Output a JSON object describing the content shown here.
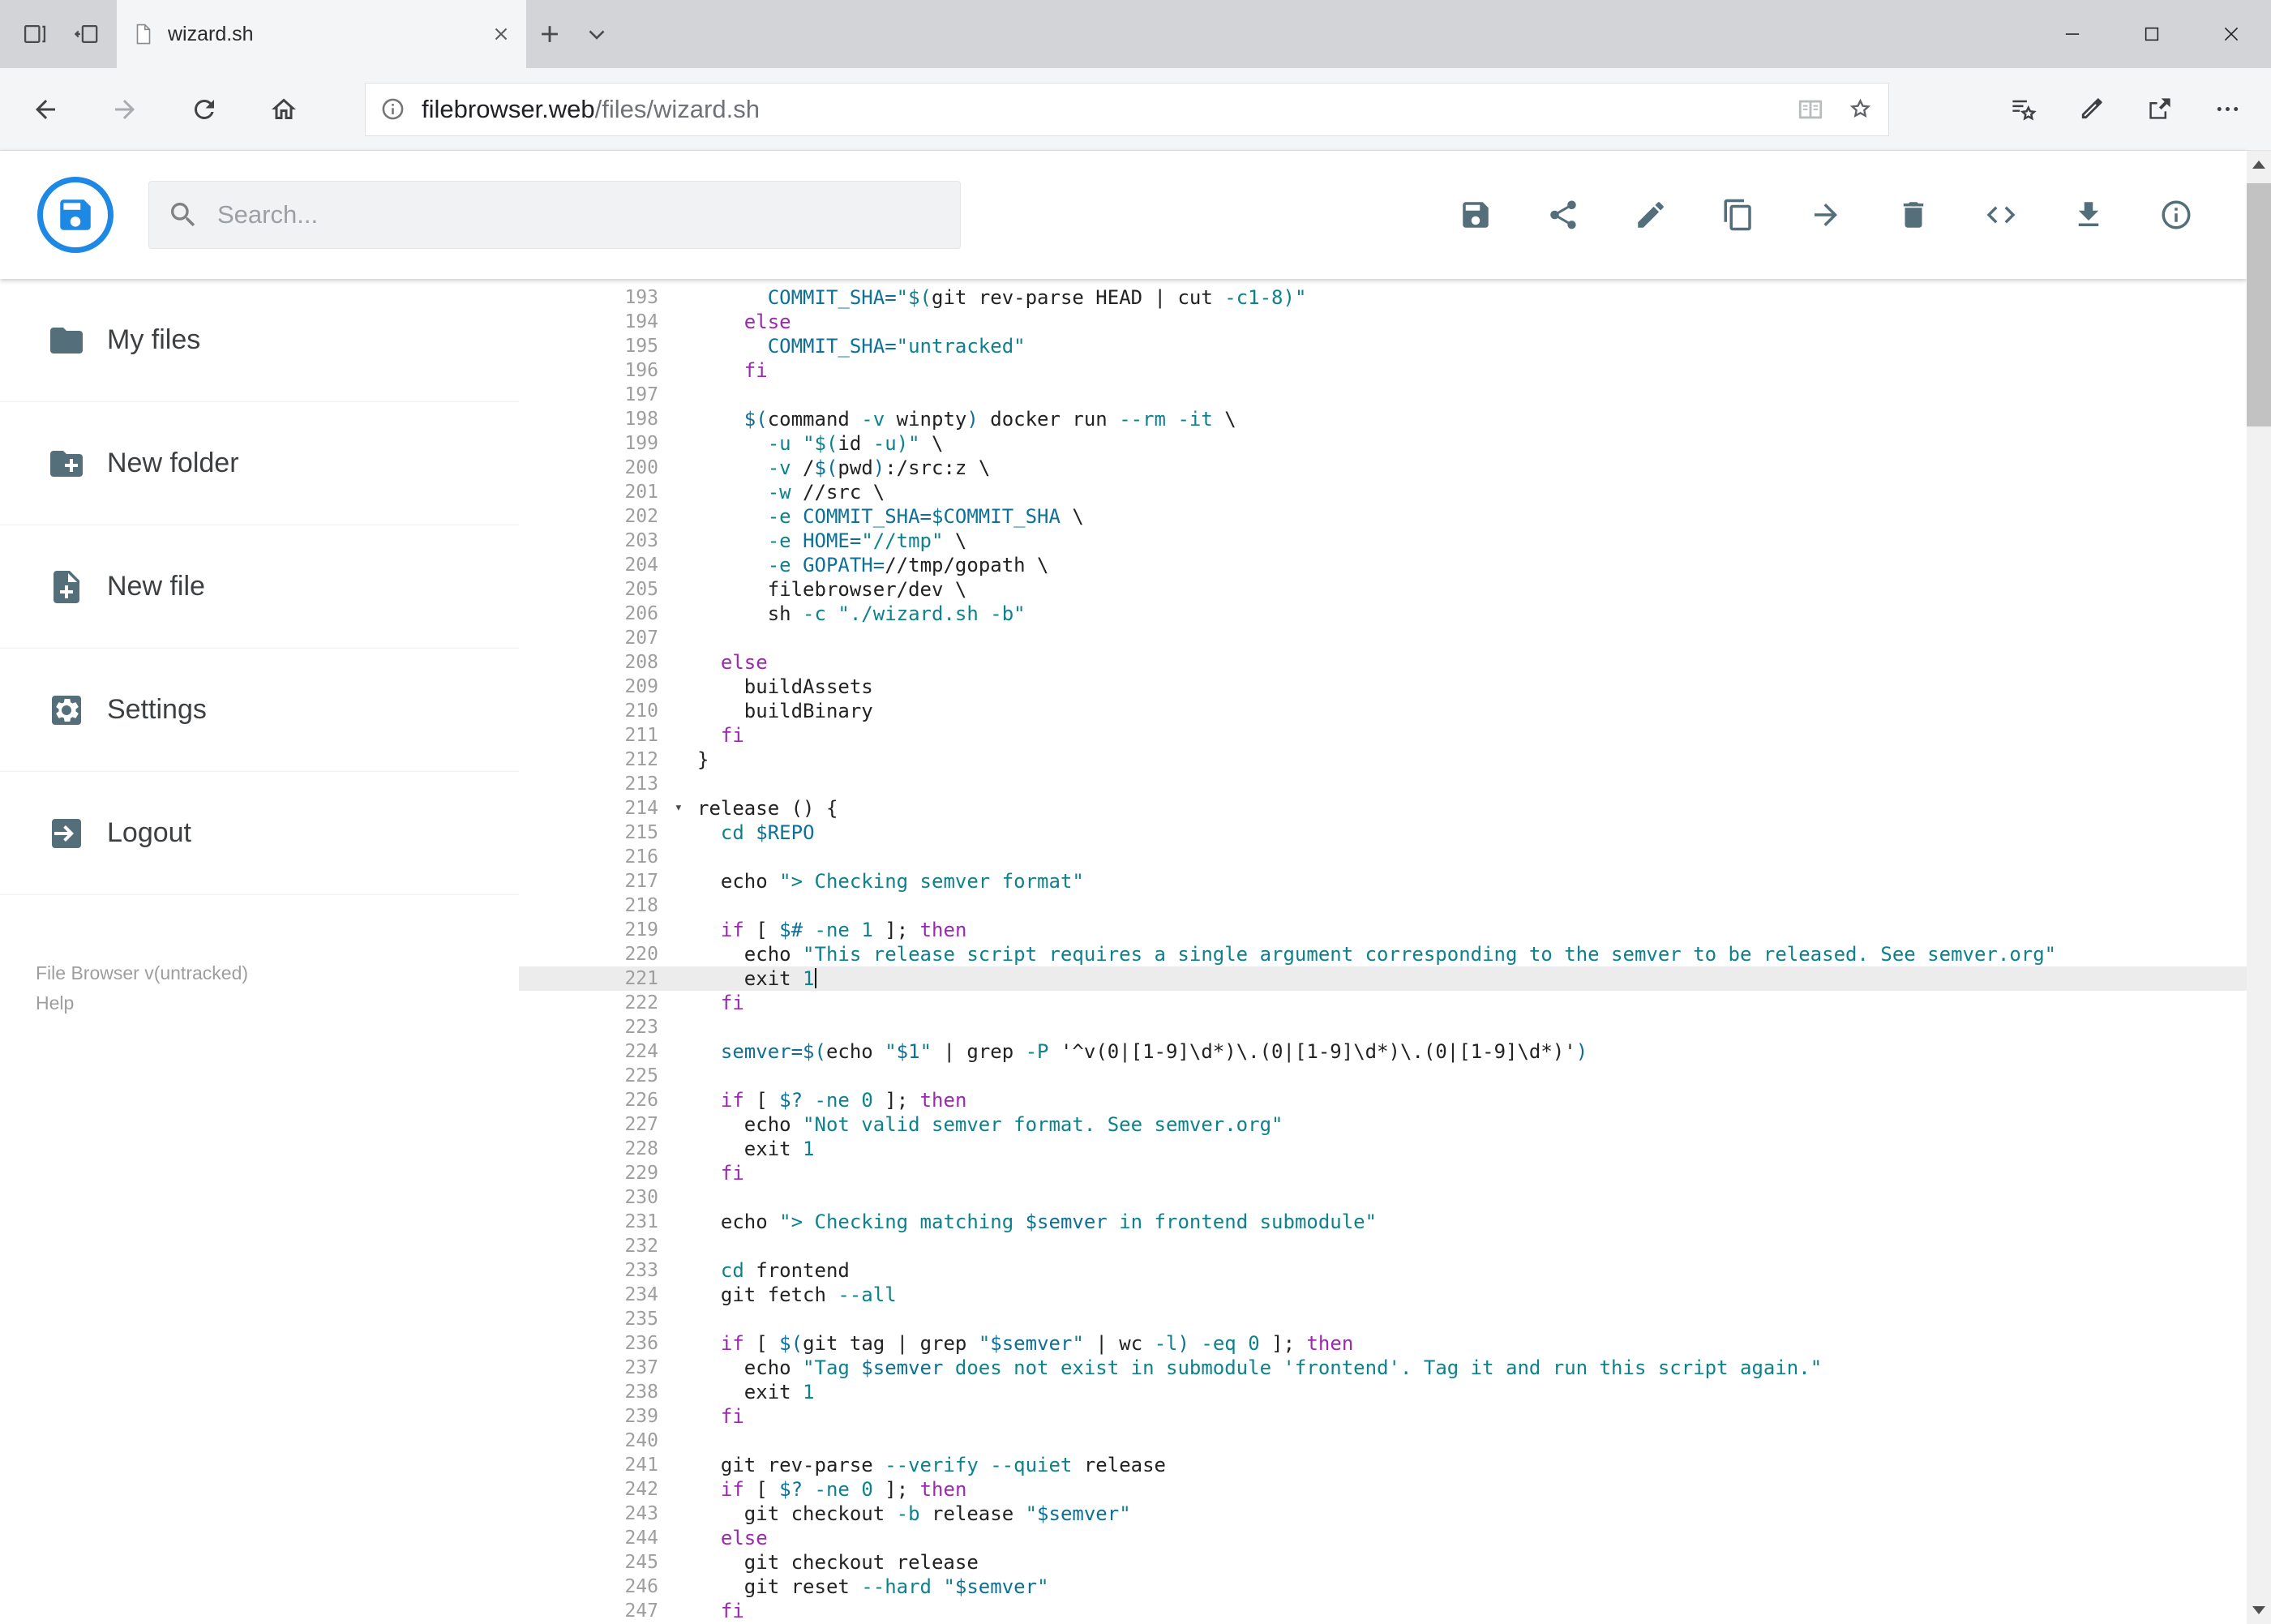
{
  "browser": {
    "tab_title": "wizard.sh",
    "url_domain": "filebrowser.web",
    "url_path": "/files/wizard.sh"
  },
  "header": {
    "search_placeholder": "Search...",
    "actions": [
      {
        "name": "save",
        "icon": "save"
      },
      {
        "name": "share",
        "icon": "share"
      },
      {
        "name": "rename",
        "icon": "pencil"
      },
      {
        "name": "copy",
        "icon": "copy"
      },
      {
        "name": "move",
        "icon": "arrow-forward"
      },
      {
        "name": "delete",
        "icon": "trash"
      },
      {
        "name": "code",
        "icon": "code"
      },
      {
        "name": "download",
        "icon": "download"
      },
      {
        "name": "info",
        "icon": "info"
      }
    ]
  },
  "sidebar": {
    "items": [
      {
        "label": "My files",
        "icon": "folder"
      },
      {
        "label": "New folder",
        "icon": "folder-plus"
      },
      {
        "label": "New file",
        "icon": "file-plus"
      },
      {
        "label": "Settings",
        "icon": "settings"
      },
      {
        "label": "Logout",
        "icon": "logout"
      }
    ],
    "footer_version": "File Browser v(untracked)",
    "footer_help": "Help"
  },
  "editor": {
    "active_line": 221,
    "fold_line": 214,
    "lines": [
      {
        "n": 193,
        "s": [
          [
            "p",
            "      "
          ],
          [
            "v",
            "COMMIT_SHA="
          ],
          [
            "s",
            "\"$("
          ],
          [
            "p",
            "git rev-parse HEAD | cut "
          ],
          [
            "s",
            "-c1-8"
          ],
          [
            "s",
            ")\""
          ]
        ]
      },
      {
        "n": 194,
        "s": [
          [
            "p",
            "    "
          ],
          [
            "k",
            "else"
          ]
        ]
      },
      {
        "n": 195,
        "s": [
          [
            "p",
            "      "
          ],
          [
            "v",
            "COMMIT_SHA="
          ],
          [
            "s",
            "\"untracked\""
          ]
        ]
      },
      {
        "n": 196,
        "s": [
          [
            "p",
            "    "
          ],
          [
            "k",
            "fi"
          ]
        ]
      },
      {
        "n": 197,
        "s": []
      },
      {
        "n": 198,
        "s": [
          [
            "p",
            "    "
          ],
          [
            "v",
            "$("
          ],
          [
            "p",
            "command "
          ],
          [
            "s",
            "-v"
          ],
          [
            "p",
            " winpty"
          ],
          [
            "v",
            ")"
          ],
          [
            "p",
            " docker run "
          ],
          [
            "s",
            "--rm"
          ],
          [
            "p",
            " "
          ],
          [
            "s",
            "-it"
          ],
          [
            "p",
            " \\"
          ]
        ]
      },
      {
        "n": 199,
        "s": [
          [
            "p",
            "      "
          ],
          [
            "s",
            "-u"
          ],
          [
            "p",
            " "
          ],
          [
            "s",
            "\"$("
          ],
          [
            "p",
            "id "
          ],
          [
            "s",
            "-u"
          ],
          [
            "s",
            ")\""
          ],
          [
            "p",
            " \\"
          ]
        ]
      },
      {
        "n": 200,
        "s": [
          [
            "p",
            "      "
          ],
          [
            "s",
            "-v"
          ],
          [
            "p",
            " /"
          ],
          [
            "v",
            "$("
          ],
          [
            "p",
            "pwd"
          ],
          [
            "v",
            ")"
          ],
          [
            "p",
            ":/src:z \\"
          ]
        ]
      },
      {
        "n": 201,
        "s": [
          [
            "p",
            "      "
          ],
          [
            "s",
            "-w"
          ],
          [
            "p",
            " //src \\"
          ]
        ]
      },
      {
        "n": 202,
        "s": [
          [
            "p",
            "      "
          ],
          [
            "s",
            "-e"
          ],
          [
            "p",
            " "
          ],
          [
            "v",
            "COMMIT_SHA=$COMMIT_SHA"
          ],
          [
            "p",
            " \\"
          ]
        ]
      },
      {
        "n": 203,
        "s": [
          [
            "p",
            "      "
          ],
          [
            "s",
            "-e"
          ],
          [
            "p",
            " "
          ],
          [
            "v",
            "HOME="
          ],
          [
            "s",
            "\"//tmp\""
          ],
          [
            "p",
            " \\"
          ]
        ]
      },
      {
        "n": 204,
        "s": [
          [
            "p",
            "      "
          ],
          [
            "s",
            "-e"
          ],
          [
            "p",
            " "
          ],
          [
            "v",
            "GOPATH="
          ],
          [
            "p",
            "//tmp/gopath \\"
          ]
        ]
      },
      {
        "n": 205,
        "s": [
          [
            "p",
            "      filebrowser/dev \\"
          ]
        ]
      },
      {
        "n": 206,
        "s": [
          [
            "p",
            "      sh "
          ],
          [
            "s",
            "-c"
          ],
          [
            "p",
            " "
          ],
          [
            "s",
            "\"./wizard.sh -b\""
          ]
        ]
      },
      {
        "n": 207,
        "s": []
      },
      {
        "n": 208,
        "s": [
          [
            "p",
            "  "
          ],
          [
            "k",
            "else"
          ]
        ]
      },
      {
        "n": 209,
        "s": [
          [
            "p",
            "    buildAssets"
          ]
        ]
      },
      {
        "n": 210,
        "s": [
          [
            "p",
            "    buildBinary"
          ]
        ]
      },
      {
        "n": 211,
        "s": [
          [
            "p",
            "  "
          ],
          [
            "k",
            "fi"
          ]
        ]
      },
      {
        "n": 212,
        "s": [
          [
            "p",
            "}"
          ]
        ]
      },
      {
        "n": 213,
        "s": []
      },
      {
        "n": 214,
        "s": [
          [
            "p",
            "release () {"
          ]
        ]
      },
      {
        "n": 215,
        "s": [
          [
            "p",
            "  "
          ],
          [
            "s",
            "cd"
          ],
          [
            "p",
            " "
          ],
          [
            "v",
            "$REPO"
          ]
        ]
      },
      {
        "n": 216,
        "s": []
      },
      {
        "n": 217,
        "s": [
          [
            "p",
            "  echo "
          ],
          [
            "s",
            "\"> Checking semver format\""
          ]
        ]
      },
      {
        "n": 218,
        "s": []
      },
      {
        "n": 219,
        "s": [
          [
            "p",
            "  "
          ],
          [
            "k",
            "if"
          ],
          [
            "p",
            " [ "
          ],
          [
            "v",
            "$#"
          ],
          [
            "p",
            " "
          ],
          [
            "s",
            "-ne"
          ],
          [
            "p",
            " "
          ],
          [
            "s",
            "1"
          ],
          [
            "p",
            " ]; "
          ],
          [
            "k",
            "then"
          ]
        ]
      },
      {
        "n": 220,
        "s": [
          [
            "p",
            "    echo "
          ],
          [
            "s",
            "\"This release script requires a single argument corresponding to the semver to be released. See semver.org\""
          ]
        ]
      },
      {
        "n": 221,
        "s": [
          [
            "p",
            "    exit "
          ],
          [
            "s",
            "1"
          ]
        ]
      },
      {
        "n": 222,
        "s": [
          [
            "p",
            "  "
          ],
          [
            "k",
            "fi"
          ]
        ]
      },
      {
        "n": 223,
        "s": []
      },
      {
        "n": 224,
        "s": [
          [
            "p",
            "  "
          ],
          [
            "v",
            "semver=$("
          ],
          [
            "p",
            "echo "
          ],
          [
            "s",
            "\""
          ],
          [
            "v",
            "$1"
          ],
          [
            "s",
            "\""
          ],
          [
            "p",
            " | grep "
          ],
          [
            "s",
            "-P"
          ],
          [
            "p",
            " '^v(0|[1-9]\\d*)\\.(0|[1-9]\\d*)\\.(0|[1-9]\\d*)'"
          ],
          [
            "v",
            ")"
          ]
        ]
      },
      {
        "n": 225,
        "s": []
      },
      {
        "n": 226,
        "s": [
          [
            "p",
            "  "
          ],
          [
            "k",
            "if"
          ],
          [
            "p",
            " [ "
          ],
          [
            "v",
            "$?"
          ],
          [
            "p",
            " "
          ],
          [
            "s",
            "-ne"
          ],
          [
            "p",
            " "
          ],
          [
            "s",
            "0"
          ],
          [
            "p",
            " ]; "
          ],
          [
            "k",
            "then"
          ]
        ]
      },
      {
        "n": 227,
        "s": [
          [
            "p",
            "    echo "
          ],
          [
            "s",
            "\"Not valid semver format. See semver.org\""
          ]
        ]
      },
      {
        "n": 228,
        "s": [
          [
            "p",
            "    exit "
          ],
          [
            "s",
            "1"
          ]
        ]
      },
      {
        "n": 229,
        "s": [
          [
            "p",
            "  "
          ],
          [
            "k",
            "fi"
          ]
        ]
      },
      {
        "n": 230,
        "s": []
      },
      {
        "n": 231,
        "s": [
          [
            "p",
            "  echo "
          ],
          [
            "s",
            "\"> Checking matching "
          ],
          [
            "v",
            "$semver"
          ],
          [
            "s",
            " in frontend submodule\""
          ]
        ]
      },
      {
        "n": 232,
        "s": []
      },
      {
        "n": 233,
        "s": [
          [
            "p",
            "  "
          ],
          [
            "s",
            "cd"
          ],
          [
            "p",
            " frontend"
          ]
        ]
      },
      {
        "n": 234,
        "s": [
          [
            "p",
            "  git fetch "
          ],
          [
            "s",
            "--all"
          ]
        ]
      },
      {
        "n": 235,
        "s": []
      },
      {
        "n": 236,
        "s": [
          [
            "p",
            "  "
          ],
          [
            "k",
            "if"
          ],
          [
            "p",
            " [ "
          ],
          [
            "v",
            "$("
          ],
          [
            "p",
            "git tag | grep "
          ],
          [
            "s",
            "\""
          ],
          [
            "v",
            "$semver"
          ],
          [
            "s",
            "\""
          ],
          [
            "p",
            " | wc "
          ],
          [
            "s",
            "-l"
          ],
          [
            "v",
            ")"
          ],
          [
            "p",
            " "
          ],
          [
            "s",
            "-eq"
          ],
          [
            "p",
            " "
          ],
          [
            "s",
            "0"
          ],
          [
            "p",
            " ]; "
          ],
          [
            "k",
            "then"
          ]
        ]
      },
      {
        "n": 237,
        "s": [
          [
            "p",
            "    echo "
          ],
          [
            "s",
            "\"Tag "
          ],
          [
            "v",
            "$semver"
          ],
          [
            "s",
            " does not exist in submodule 'frontend'. Tag it and run this script again.\""
          ]
        ]
      },
      {
        "n": 238,
        "s": [
          [
            "p",
            "    exit "
          ],
          [
            "s",
            "1"
          ]
        ]
      },
      {
        "n": 239,
        "s": [
          [
            "p",
            "  "
          ],
          [
            "k",
            "fi"
          ]
        ]
      },
      {
        "n": 240,
        "s": []
      },
      {
        "n": 241,
        "s": [
          [
            "p",
            "  git rev-parse "
          ],
          [
            "s",
            "--verify"
          ],
          [
            "p",
            " "
          ],
          [
            "s",
            "--quiet"
          ],
          [
            "p",
            " release"
          ]
        ]
      },
      {
        "n": 242,
        "s": [
          [
            "p",
            "  "
          ],
          [
            "k",
            "if"
          ],
          [
            "p",
            " [ "
          ],
          [
            "v",
            "$?"
          ],
          [
            "p",
            " "
          ],
          [
            "s",
            "-ne"
          ],
          [
            "p",
            " "
          ],
          [
            "s",
            "0"
          ],
          [
            "p",
            " ]; "
          ],
          [
            "k",
            "then"
          ]
        ]
      },
      {
        "n": 243,
        "s": [
          [
            "p",
            "    git checkout "
          ],
          [
            "s",
            "-b"
          ],
          [
            "p",
            " release "
          ],
          [
            "s",
            "\""
          ],
          [
            "v",
            "$semver"
          ],
          [
            "s",
            "\""
          ]
        ]
      },
      {
        "n": 244,
        "s": [
          [
            "p",
            "  "
          ],
          [
            "k",
            "else"
          ]
        ]
      },
      {
        "n": 245,
        "s": [
          [
            "p",
            "    git checkout release"
          ]
        ]
      },
      {
        "n": 246,
        "s": [
          [
            "p",
            "    git reset "
          ],
          [
            "s",
            "--hard"
          ],
          [
            "p",
            " "
          ],
          [
            "s",
            "\""
          ],
          [
            "v",
            "$semver"
          ],
          [
            "s",
            "\""
          ]
        ]
      },
      {
        "n": 247,
        "s": [
          [
            "p",
            "  "
          ],
          [
            "k",
            "fi"
          ]
        ]
      }
    ]
  },
  "colors": {
    "accent_blue": "#1e88e5",
    "icon_gray": "#546e7a",
    "keyword": "#9c27b0",
    "string_teal": "#0e828c",
    "variable_teal": "#0e7099",
    "active_line_bg": "#ececec"
  }
}
